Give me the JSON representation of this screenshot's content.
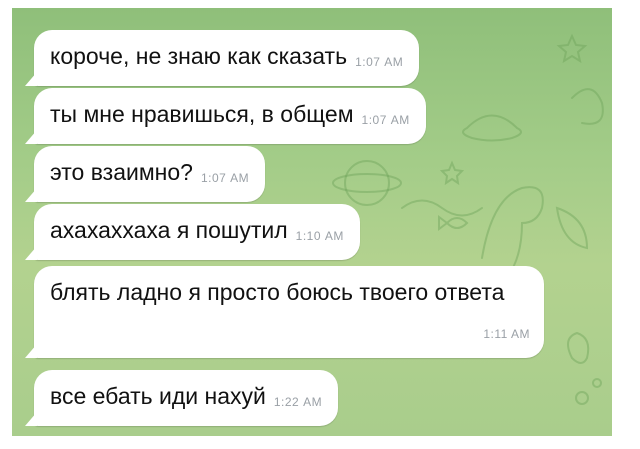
{
  "chat": {
    "background_color": "#a3cc88",
    "bubble_color": "#ffffff",
    "messages": [
      {
        "text": "короче, не знаю как сказать",
        "time": "1:07 AM"
      },
      {
        "text": "ты мне нравишься, в общем",
        "time": "1:07 AM"
      },
      {
        "text": "это взаимно?",
        "time": "1:07 AM"
      },
      {
        "text": "ахахаххаха я пошутил",
        "time": "1:10 AM"
      },
      {
        "text": "блять ладно я просто боюсь твоего ответа",
        "time": "1:11 AM"
      },
      {
        "text": "все ебать иди нахуй",
        "time": "1:22 AM"
      }
    ]
  }
}
